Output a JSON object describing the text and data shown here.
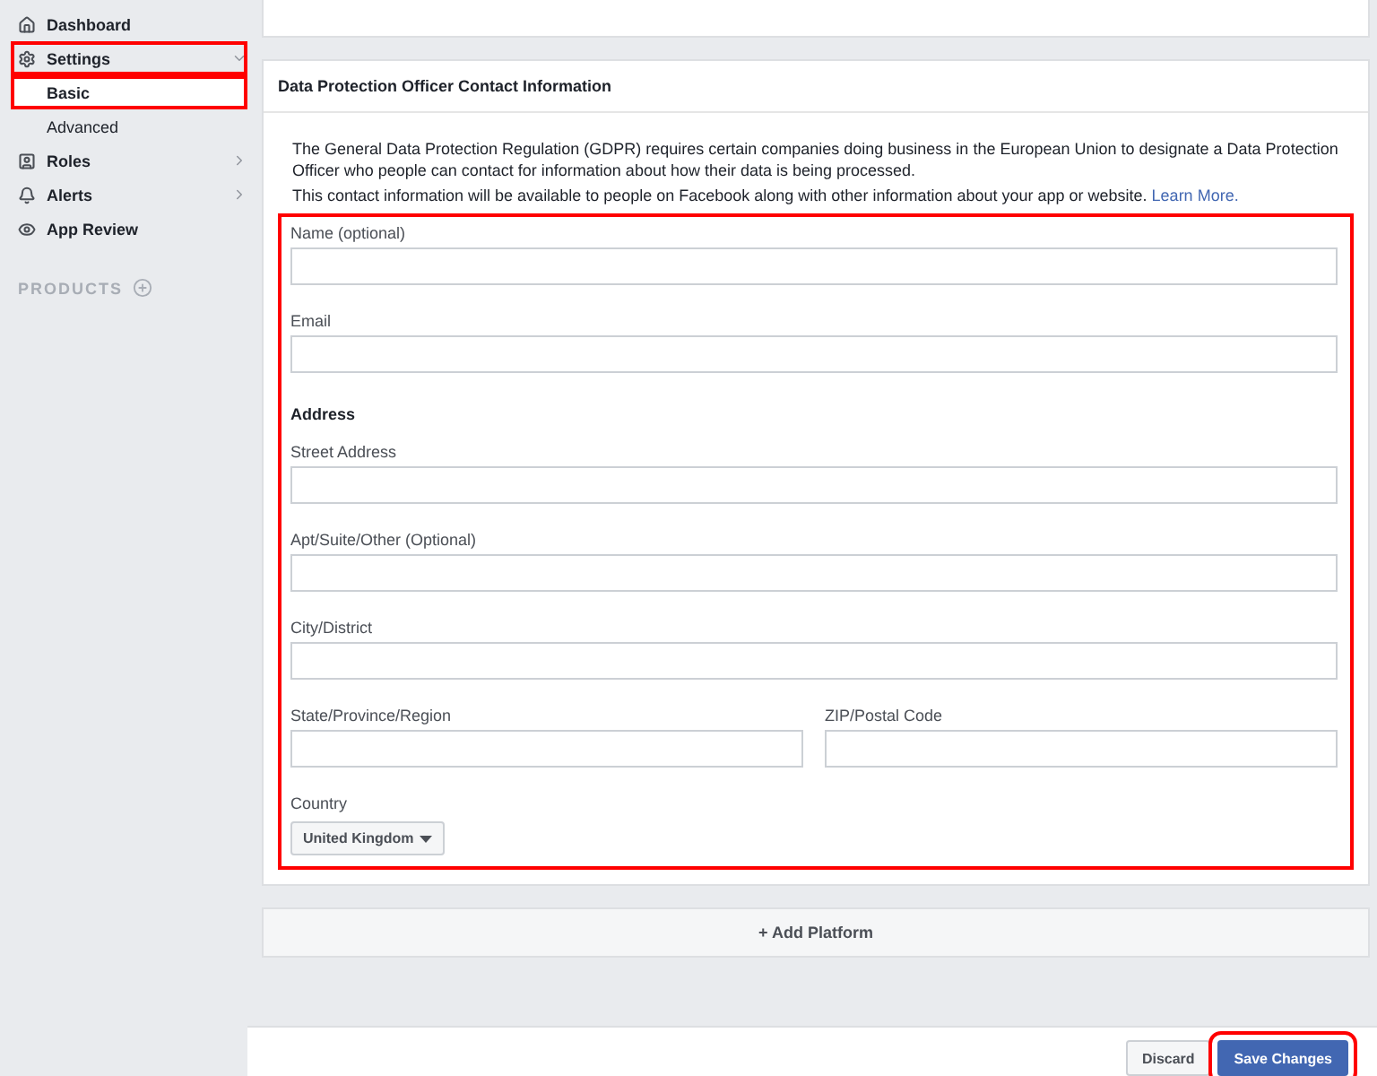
{
  "sidebar": {
    "items": [
      {
        "label": "Dashboard",
        "kind": "home",
        "highlighted": false,
        "selected": false
      },
      {
        "label": "Settings",
        "kind": "gear",
        "highlighted": true,
        "selected": false,
        "expanded": true
      },
      {
        "label": "Basic",
        "kind": "sub",
        "highlighted": true,
        "selected": true
      },
      {
        "label": "Advanced",
        "kind": "sub",
        "highlighted": false,
        "selected": false
      },
      {
        "label": "Roles",
        "kind": "roles",
        "highlighted": false,
        "selected": false,
        "expanded": false
      },
      {
        "label": "Alerts",
        "kind": "bell",
        "highlighted": false,
        "selected": false,
        "expanded": false
      },
      {
        "label": "App Review",
        "kind": "eye",
        "highlighted": false,
        "selected": false
      }
    ],
    "section": "PRODUCTS"
  },
  "card": {
    "title": "Data Protection Officer Contact Information",
    "intro": "The General Data Protection Regulation (GDPR) requires certain companies doing business in the European Union to designate a Data Protection Officer who people can contact for information about how their data is being processed.",
    "note": "This contact information will be available to people on Facebook along with other information about your app or website.",
    "link": "Learn More.",
    "highlighted": true,
    "fields": [
      {
        "kind": "input",
        "label": "Name (optional)"
      },
      {
        "kind": "input",
        "label": "Email"
      },
      {
        "kind": "heading",
        "label": "Address"
      },
      {
        "kind": "input",
        "label": "Street Address"
      },
      {
        "kind": "input",
        "label": "Apt/Suite/Other (Optional)"
      },
      {
        "kind": "input",
        "label": "City/District"
      },
      {
        "kind": "pair",
        "label": "State/Province/Region",
        "label2": "ZIP/Postal Code"
      },
      {
        "kind": "select",
        "label": "Country",
        "value": "United Kingdom"
      }
    ]
  },
  "add_platform": "+ Add Platform",
  "footer": {
    "buttons": [
      {
        "label": "Discard",
        "primary": false,
        "highlighted": false
      },
      {
        "label": "Save Changes",
        "primary": true,
        "highlighted": true
      }
    ]
  }
}
